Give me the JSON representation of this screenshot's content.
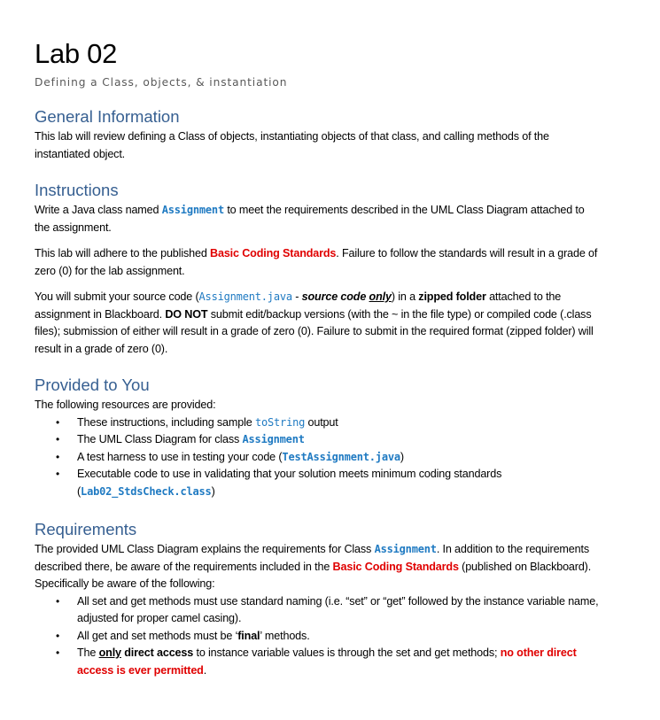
{
  "document": {
    "title": "Lab 02",
    "subtitle": "Defining a Class, objects, & instantiation"
  },
  "sections": {
    "general": {
      "heading": "General Information",
      "para": "This lab will review defining a Class of objects, instantiating objects of that class, and calling methods of the instantiated object."
    },
    "instructions": {
      "heading": "Instructions",
      "p1": {
        "a": "Write a Java class named ",
        "code": "Assignment",
        "b": " to meet the requirements described in the UML Class Diagram attached to the assignment."
      },
      "p2": {
        "a": "This lab will adhere to the published ",
        "red": "Basic Coding Standards",
        "b": ". Failure to follow the standards will result in a grade of zero (0) for the lab assignment."
      },
      "p3": {
        "a": "You will submit your source code (",
        "code": "Assignment.java",
        "dash": " - ",
        "source_code": "source code ",
        "only": "only",
        "b": ") in a ",
        "zipped": "zipped folder",
        "c": " attached to the assignment in Blackboard. ",
        "do_not": "DO NOT",
        "d": " submit edit/backup versions (with the ~ in the file type) or compiled code (",
        "class_files": ".class files",
        "e": "); submission of either will result in a grade of zero (0). Failure to submit in the required format (zipped folder) will result in a grade of zero (0)."
      }
    },
    "provided": {
      "heading": "Provided to You",
      "intro": "The following resources are provided:",
      "items": [
        {
          "a": "These instructions, including sample ",
          "code": "toString",
          "b": " output"
        },
        {
          "a": "The UML Class Diagram for class ",
          "code": "Assignment",
          "b": ""
        },
        {
          "a": "A test harness to use in testing your code (",
          "code": "TestAssignment.java",
          "b": ")"
        },
        {
          "a": "Executable code to use in validating that your solution meets minimum coding standards (",
          "code": "Lab02_StdsCheck.class",
          "b": ")"
        }
      ]
    },
    "requirements": {
      "heading": "Requirements",
      "para": {
        "a": "The provided UML Class Diagram explains the requirements for Class ",
        "code": "Assignment",
        "b": ". In addition to the requirements described there, be aware of the requirements included in the ",
        "red": "Basic Coding Standards",
        "c": " (published on Blackboard). Specifically be aware of the following:"
      },
      "items": [
        {
          "a": "All set and get methods must use standard naming (i.e. “set” or “get” followed by the instance variable name, adjusted for proper camel casing)."
        },
        {
          "a": "All get and set methods must be ‘",
          "bold": "final",
          "b": "’ methods."
        },
        {
          "a": "The ",
          "only": "only",
          "direct": " direct access",
          "b": " to instance variable values is through the set and get methods; ",
          "red": "no other direct access is ever permitted",
          "c": "."
        }
      ]
    }
  },
  "icons": {
    "bullet": "•"
  },
  "colors": {
    "heading": "#365f91",
    "code": "#1f7ac2",
    "emphasis_red": "#e00000",
    "subtitle": "#595959"
  }
}
